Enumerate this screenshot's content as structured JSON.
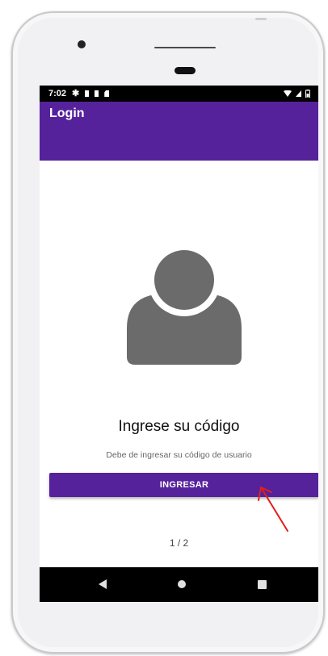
{
  "status_bar": {
    "time": "7:02",
    "left_icons": [
      "gear-icon",
      "notification-block-icon",
      "notification-block-icon",
      "sd-card-icon"
    ],
    "right_icons": [
      "wifi-icon",
      "signal-icon",
      "battery-icon"
    ]
  },
  "app_bar": {
    "title": "Login",
    "color": "#55229c"
  },
  "content": {
    "avatar_icon": "user-avatar-icon",
    "heading": "Ingrese su código",
    "subtext": "Debe de ingresar su código de usuario",
    "button_label": "INGRESAR",
    "pager": "1 / 2"
  },
  "nav_bar": {
    "items": [
      "back-icon",
      "home-icon",
      "recents-icon"
    ]
  },
  "annotation": {
    "color": "#e0201c"
  }
}
